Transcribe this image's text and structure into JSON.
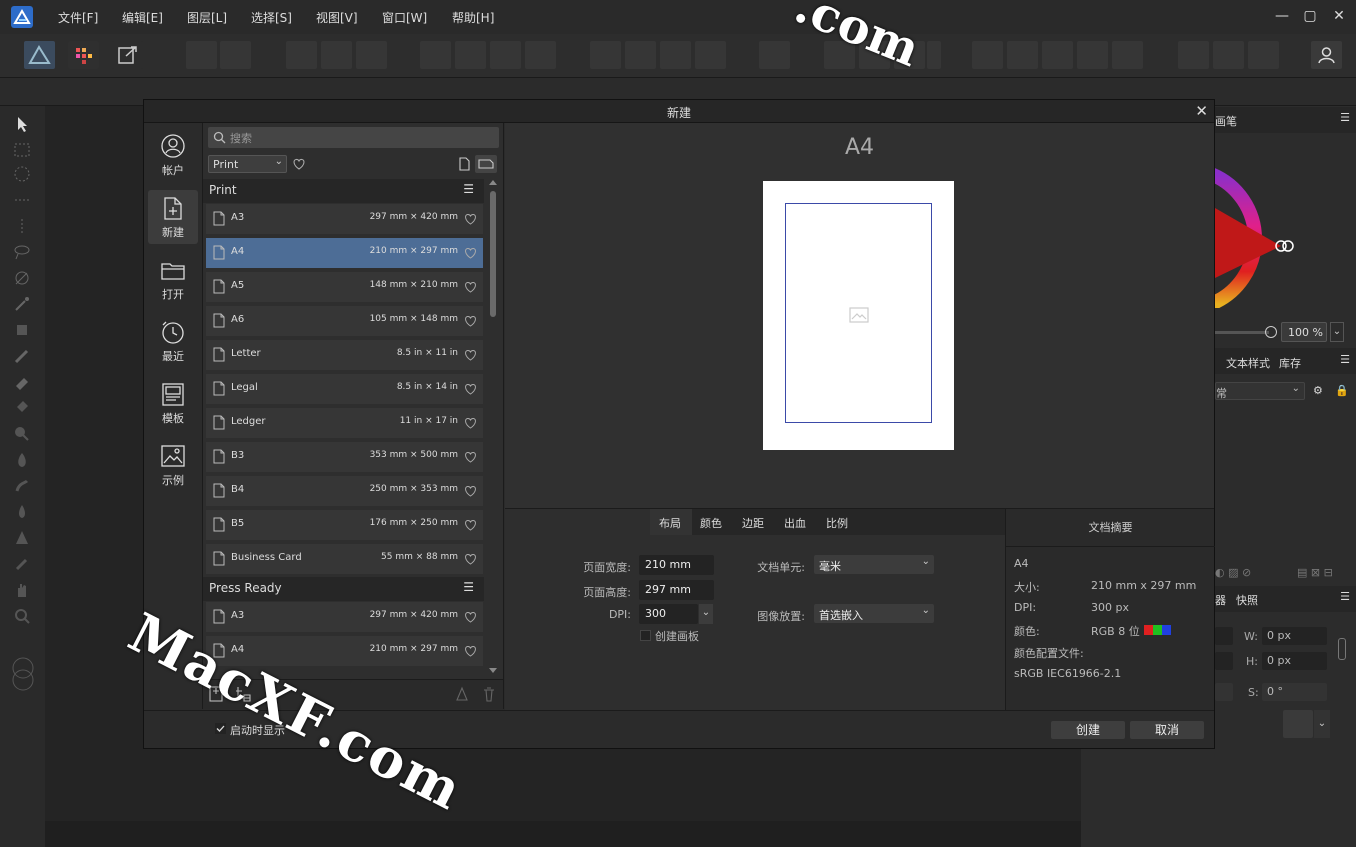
{
  "menubar": {
    "items": [
      "文件[F]",
      "编辑[E]",
      "图层[L]",
      "选择[S]",
      "视图[V]",
      "窗口[W]",
      "帮助[H]"
    ]
  },
  "dialog": {
    "title": "新建",
    "sidebar": [
      {
        "label": "帐户",
        "icon": "account-icon"
      },
      {
        "label": "新建",
        "icon": "new-document-icon"
      },
      {
        "label": "打开",
        "icon": "open-folder-icon"
      },
      {
        "label": "最近",
        "icon": "recent-clock-icon"
      },
      {
        "label": "模板",
        "icon": "templates-icon"
      },
      {
        "label": "示例",
        "icon": "samples-icon"
      }
    ],
    "search_placeholder": "搜索",
    "type_select": "Print",
    "groups": [
      {
        "name": "Print",
        "presets": [
          {
            "name": "A3",
            "size": "297 mm × 420 mm"
          },
          {
            "name": "A4",
            "size": "210 mm × 297 mm",
            "selected": true
          },
          {
            "name": "A5",
            "size": "148 mm × 210 mm"
          },
          {
            "name": "A6",
            "size": "105 mm × 148 mm"
          },
          {
            "name": "Letter",
            "size": "8.5 in × 11 in"
          },
          {
            "name": "Legal",
            "size": "8.5 in × 14 in"
          },
          {
            "name": "Ledger",
            "size": "11 in × 17 in"
          },
          {
            "name": "B3",
            "size": "353 mm × 500 mm"
          },
          {
            "name": "B4",
            "size": "250 mm × 353 mm"
          },
          {
            "name": "B5",
            "size": "176 mm × 250 mm"
          },
          {
            "name": "Business Card",
            "size": "55 mm × 88 mm"
          }
        ]
      },
      {
        "name": "Press Ready",
        "presets": [
          {
            "name": "A3",
            "size": "297 mm × 420 mm"
          },
          {
            "name": "A4",
            "size": "210 mm × 297 mm"
          }
        ]
      }
    ],
    "preview_name": "A4",
    "tabs": [
      "布局",
      "颜色",
      "边距",
      "出血",
      "比例"
    ],
    "layout": {
      "page_width_label": "页面宽度:",
      "page_width": "210 mm",
      "page_height_label": "页面高度:",
      "page_height": "297 mm",
      "dpi_label": "DPI:",
      "dpi": "300",
      "create_artboard": "创建画板",
      "doc_units_label": "文档单元:",
      "doc_units": "毫米",
      "image_placement_label": "图像放置:",
      "image_placement": "首选嵌入"
    },
    "summary": {
      "title": "文档摘要",
      "name": "A4",
      "size_label": "大小:",
      "size": "210 mm  x  297 mm",
      "dpi_label": "DPI:",
      "dpi": "300 px",
      "color_label": "颜色:",
      "color": "RGB 8 位",
      "profile_label": "颜色配置文件:",
      "profile": "sRGB IEC61966-2.1"
    },
    "show_on_startup": "启动时显示",
    "create_button": "创建",
    "cancel_button": "取消"
  },
  "right_panel": {
    "brush_tab": "画笔",
    "zoom": "100 %",
    "text_style_tab": "文本样式",
    "library_tab": "库存",
    "blend_mode": "常",
    "transform_tab_a": "器",
    "transform_tab_b": "快照",
    "w_label": "W:",
    "w_value": "0 px",
    "h_label": "H:",
    "h_value": "0 px",
    "s_label": "S:",
    "s_value": "0 °"
  },
  "watermarks": [
    "MacXF.com",
    ".com"
  ],
  "colors": {
    "selection": "#4d6d96",
    "margin_guide": "#3b4aa8"
  }
}
